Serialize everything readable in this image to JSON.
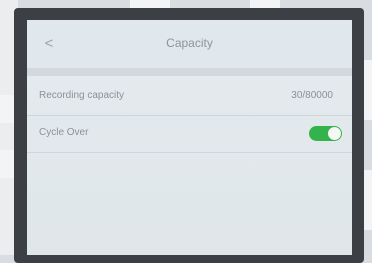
{
  "header": {
    "back_glyph": "<",
    "title": "Capacity"
  },
  "settings": {
    "recording_capacity": {
      "label": "Recording capacity",
      "value": "30/80000"
    },
    "cycle_over": {
      "label": "Cycle Over",
      "enabled": true
    }
  },
  "colors": {
    "toggle_on": "#32b34b",
    "screen_bg": "#e3e9ee",
    "text": "#8a9298"
  }
}
